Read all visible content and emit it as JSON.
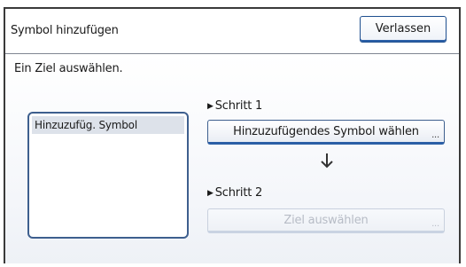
{
  "header": {
    "title": "Symbol hinzufügen",
    "exit_label": "Verlassen"
  },
  "main": {
    "instruction": "Ein Ziel auswählen.",
    "list": {
      "items": [
        {
          "label": "Hinzuzufüg. Symbol",
          "selected": true
        }
      ]
    },
    "step1": {
      "label": "Schritt 1",
      "button_label": "Hinzuzufügendes Symbol wählen",
      "button_ellipsis": "..."
    },
    "step2": {
      "label": "Schritt 2",
      "button_label": "Ziel auswählen",
      "button_ellipsis": "...",
      "button_enabled": false
    },
    "step_marker_icon": "right-triangle-icon",
    "flow_icon": "arrow-down-icon"
  },
  "colors": {
    "accent_border": "#2b5fa6",
    "list_border": "#3e5f8e",
    "selected_row": "#dde2ea",
    "disabled_text": "#b7bcc6"
  }
}
